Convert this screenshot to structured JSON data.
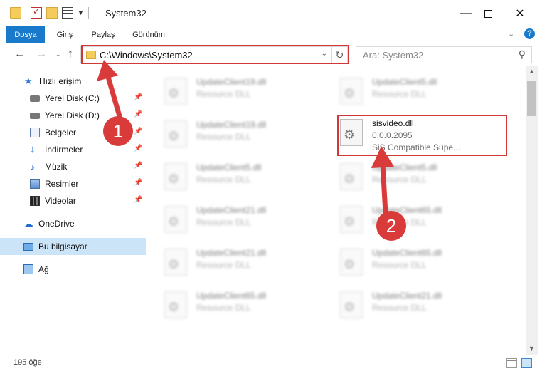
{
  "window": {
    "title": "System32",
    "minimize_glyph": "—",
    "close_glyph": "✕"
  },
  "ribbon": {
    "tabs": [
      "Dosya",
      "Giriş",
      "Paylaş",
      "Görünüm"
    ],
    "expand_glyph": "⌄",
    "help_glyph": "?"
  },
  "address_bar": {
    "path": "C:\\Windows\\System32",
    "search_placeholder": "Ara: System32",
    "back_glyph": "←",
    "forward_glyph": "→",
    "recent_glyph": "⌄",
    "up_glyph": "↑",
    "dropdown_glyph": "⌄",
    "refresh_glyph": "↻",
    "search_glyph": "⚲"
  },
  "sidebar": {
    "pin_glyph": "📌",
    "items": [
      {
        "label": "Hızlı erişim",
        "icon": "star-icon",
        "glyph": "★"
      },
      {
        "label": "Yerel Disk (C:)",
        "icon": "disk-icon",
        "pinned": true
      },
      {
        "label": "Yerel Disk (D:)",
        "icon": "disk-icon",
        "pinned": true
      },
      {
        "label": "Belgeler",
        "icon": "documents-icon",
        "pinned": true
      },
      {
        "label": "İndirmeler",
        "icon": "downloads-icon",
        "glyph": "↓",
        "pinned": true
      },
      {
        "label": "Müzik",
        "icon": "music-icon",
        "glyph": "♪",
        "pinned": true
      },
      {
        "label": "Resimler",
        "icon": "pictures-icon",
        "pinned": true
      },
      {
        "label": "Videolar",
        "icon": "videos-icon",
        "pinned": true
      },
      {
        "label": "OneDrive",
        "icon": "cloud-icon",
        "glyph": "☁"
      },
      {
        "label": "Bu bilgisayar",
        "icon": "computer-icon",
        "selected": true
      },
      {
        "label": "Ağ",
        "icon": "network-icon"
      }
    ]
  },
  "files": {
    "gear_glyph": "⚙",
    "left_column": [
      {
        "name": "UpdateClient19.dll",
        "type": "Resource DLL"
      },
      {
        "name": "UpdateClient19.dll",
        "type": "Resource DLL"
      },
      {
        "name": "UpdateClient5.dll",
        "type": "Resource DLL"
      },
      {
        "name": "UpdateClient21.dll",
        "type": "Resource DLL"
      },
      {
        "name": "UpdateClient21.dll",
        "type": "Resource DLL"
      },
      {
        "name": "UpdateClient65.dll",
        "type": "Resource DLL"
      }
    ],
    "right_column": [
      {
        "name": "UpdateClient5.dll",
        "type": "Resource DLL"
      },
      {
        "name": "sisvideo.dll",
        "version": "0.0.0.2095",
        "description": "SiS Compatible Supe..."
      },
      {
        "name": "UpdateClient5.dll",
        "type": "Resource DLL"
      },
      {
        "name": "UpdateClient65.dll",
        "type": "Resource DLL"
      },
      {
        "name": "UpdateClient65.dll",
        "type": "Resource DLL"
      },
      {
        "name": "UpdateClient21.dll",
        "type": "Resource DLL"
      }
    ]
  },
  "scrollbar": {
    "up_glyph": "▲",
    "down_glyph": "▼"
  },
  "status_bar": {
    "item_count": "195 öğe"
  },
  "annotations": [
    {
      "number": "1",
      "color": "#d93a3a"
    },
    {
      "number": "2",
      "color": "#d93a3a"
    }
  ],
  "colors": {
    "accent": "#1979ca",
    "highlight": "#d03838",
    "selected": "#cce4f7"
  }
}
